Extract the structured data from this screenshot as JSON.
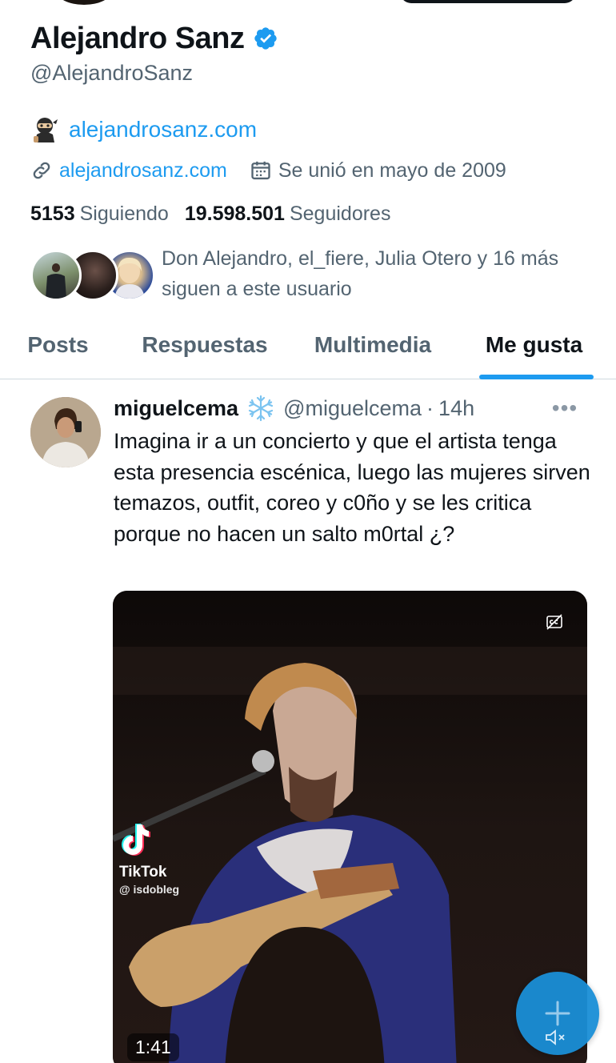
{
  "profile": {
    "display_name": "Alejandro Sanz",
    "handle": "@AlejandroSanz",
    "bio_link": "alejandrosanz.com",
    "website": "alejandrosanz.com",
    "joined": "Se unió en mayo de 2009",
    "following_count": "5153",
    "following_label": "Siguiendo",
    "followers_count": "19.598.501",
    "followers_label": "Seguidores",
    "followed_by_line1": "Don Alejandro, el_fiere, Julia Otero y 16 más",
    "followed_by_line2": "siguen a este usuario"
  },
  "tabs": [
    {
      "label": "Posts"
    },
    {
      "label": "Respuestas"
    },
    {
      "label": "Multimedia"
    },
    {
      "label": "Me gusta"
    }
  ],
  "tweet": {
    "author_name": "miguelcema",
    "author_handle": "@miguelcema",
    "separator": "·",
    "time": "14h",
    "more": "•••",
    "text": "Imagina ir a un concierto y que el artista tenga esta presencia escénica, luego las mujeres sirven temazos, outfit, coreo y c0ño y se les critica porque no hacen un salto m0rtal ¿?",
    "media": {
      "watermark_name": "TikTok",
      "watermark_user": "@ isdobleg",
      "duration": "1:41"
    }
  },
  "colors": {
    "accent": "#1d9bf0",
    "secondary_text": "#536471",
    "primary_text": "#0f1419"
  },
  "icons": {
    "verified": "verified-badge-icon",
    "link": "link-icon",
    "calendar": "calendar-icon",
    "more": "more-icon",
    "compose": "plus-icon",
    "mute": "mute-icon",
    "captions": "captions-off-icon"
  }
}
